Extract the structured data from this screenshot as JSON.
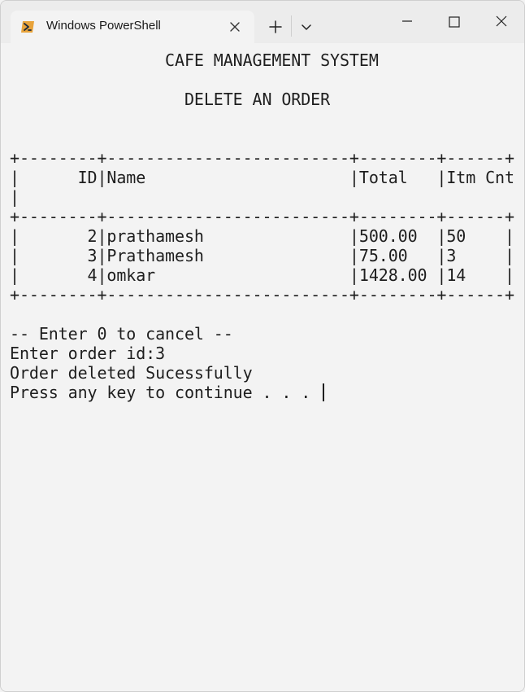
{
  "window": {
    "tab_title": "Windows PowerShell",
    "tab_icon": "powershell-icon",
    "new_tab_icon": "plus-icon",
    "dropdown_icon": "chevron-down-icon",
    "minimize_icon": "minimize-icon",
    "maximize_icon": "maximize-icon",
    "close_icon": "close-icon"
  },
  "terminal": {
    "lines": [
      "                CAFE MANAGEMENT SYSTEM",
      "",
      "                  DELETE AN ORDER",
      "",
      "",
      "+--------+-------------------------+--------+------+",
      "|      ID|Name                     |Total   |Itm Cnt",
      "|",
      "+--------+-------------------------+--------+------+",
      "|       2|prathamesh               |500.00  |50    |",
      "|       3|Prathamesh               |75.00   |3     |",
      "|       4|omkar                    |1428.00 |14    |",
      "+--------+-------------------------+--------+------+",
      "",
      "-- Enter 0 to cancel --",
      "Enter order id:3",
      "Order deleted Sucessfully",
      "Press any key to continue . . . "
    ]
  }
}
